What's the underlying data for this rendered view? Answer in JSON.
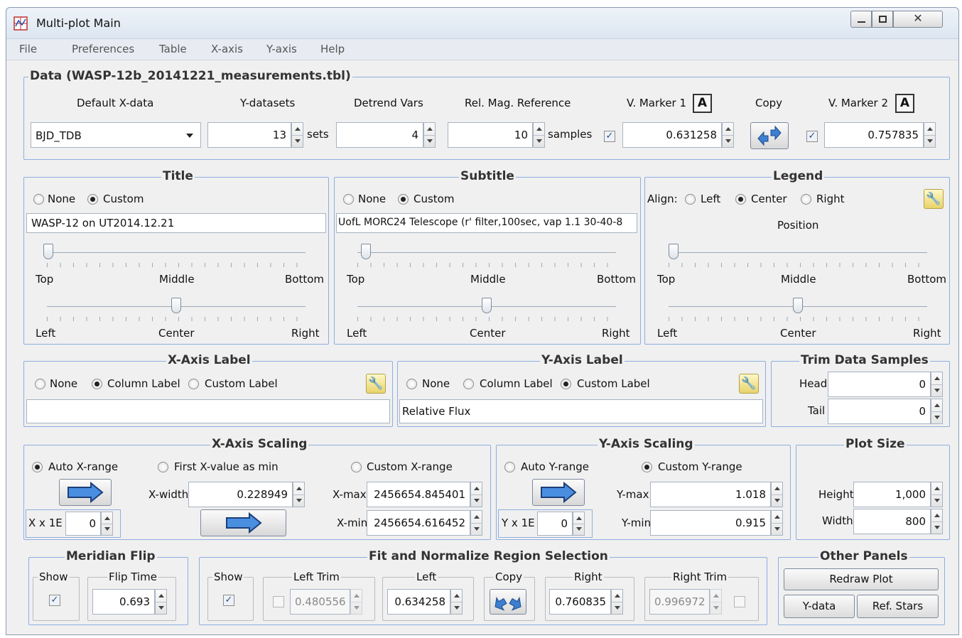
{
  "window": {
    "title": "Multi-plot Main"
  },
  "menu": [
    "File",
    "Preferences",
    "Table",
    "X-axis",
    "Y-axis",
    "Help"
  ],
  "data": {
    "legend": "Data (WASP-12b_20141221_measurements.tbl)",
    "default_x_label": "Default X-data",
    "default_x_value": "BJD_TDB",
    "ydatasets_label": "Y-datasets",
    "ydatasets_value": "13",
    "ydatasets_unit": "sets",
    "detrend_label": "Detrend Vars",
    "detrend_value": "4",
    "relmag_label": "Rel. Mag. Reference",
    "relmag_value": "10",
    "relmag_unit": "samples",
    "vmarker1_label": "V. Marker 1",
    "vmarker1_value": "0.631258",
    "vmarker_btn": "A",
    "copy_label": "Copy",
    "vmarker2_label": "V. Marker 2",
    "vmarker2_value": "0.757835"
  },
  "title": {
    "legend": "Title",
    "none": "None",
    "custom": "Custom",
    "value": "WASP-12 on UT2014.12.21",
    "top": "Top",
    "middle": "Middle",
    "bottom": "Bottom",
    "left": "Left",
    "center": "Center",
    "right": "Right"
  },
  "subtitle": {
    "legend": "Subtitle",
    "none": "None",
    "custom": "Custom",
    "value": "UofL MORC24 Telescope (r' filter,100sec, vap 1.1 30-40-8",
    "top": "Top",
    "middle": "Middle",
    "bottom": "Bottom",
    "left": "Left",
    "center": "Center",
    "right": "Right"
  },
  "legendbox": {
    "legend": "Legend",
    "align": "Align:",
    "left": "Left",
    "center": "Center",
    "right": "Right",
    "position": "Position",
    "top": "Top",
    "middle": "Middle",
    "bottom": "Bottom",
    "hleft": "Left",
    "hcenter": "Center",
    "hright": "Right"
  },
  "xlabel": {
    "legend": "X-Axis Label",
    "none": "None",
    "column": "Column Label",
    "custom": "Custom Label",
    "value": ""
  },
  "ylabel": {
    "legend": "Y-Axis Label",
    "none": "None",
    "column": "Column Label",
    "custom": "Custom Label",
    "value": "Relative Flux"
  },
  "trim": {
    "legend": "Trim Data Samples",
    "head": "Head",
    "head_value": "0",
    "tail": "Tail",
    "tail_value": "0"
  },
  "xscaling": {
    "legend": "X-Axis Scaling",
    "auto": "Auto X-range",
    "first": "First X-value as min",
    "custom": "Custom X-range",
    "xwidth_label": "X-width",
    "xwidth": "0.228949",
    "xmax_label": "X-max",
    "xmax": "2456654.845401",
    "xmin_label": "X-min",
    "xmin": "2456654.616452",
    "xx_label": "X x 1E",
    "xx": "0"
  },
  "yscaling": {
    "legend": "Y-Axis Scaling",
    "auto": "Auto Y-range",
    "custom": "Custom Y-range",
    "ymax_label": "Y-max",
    "ymax": "1.018",
    "ymin_label": "Y-min",
    "ymin": "0.915",
    "yx_label": "Y x 1E",
    "yx": "0"
  },
  "plotsize": {
    "legend": "Plot Size",
    "height_label": "Height",
    "height": "1,000",
    "width_label": "Width",
    "width": "800"
  },
  "meridian": {
    "legend": "Meridian Flip",
    "show": "Show",
    "fliptime_label": "Flip Time",
    "fliptime": "0.693"
  },
  "fit": {
    "legend": "Fit and Normalize Region Selection",
    "show": "Show",
    "lefttrim_label": "Left Trim",
    "lefttrim": "0.480556",
    "left_label": "Left",
    "left": "0.634258",
    "copy_label": "Copy",
    "right_label": "Right",
    "right": "0.760835",
    "righttrim_label": "Right Trim",
    "righttrim": "0.996972"
  },
  "other": {
    "legend": "Other Panels",
    "redraw": "Redraw Plot",
    "ydata": "Y-data",
    "refstars": "Ref. Stars"
  }
}
